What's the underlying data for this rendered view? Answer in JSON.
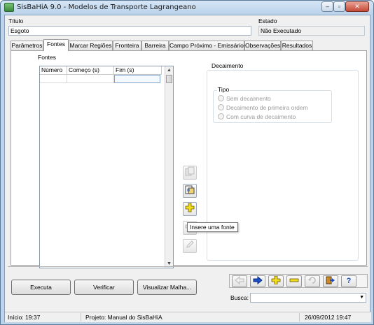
{
  "window": {
    "title": "SisBaHiA 9.0 - Modelos de Transporte Lagrangeano",
    "minimize": "–",
    "maximize": "▫",
    "close": "✕"
  },
  "form": {
    "titulo_label": "Título",
    "titulo_value": "Esgoto",
    "estado_label": "Estado",
    "estado_value": "Não Executado"
  },
  "tabs": [
    {
      "label": "Parâmetros"
    },
    {
      "label": "Fontes"
    },
    {
      "label": "Marcar Regiões"
    },
    {
      "label": "Fronteira"
    },
    {
      "label": "Barreira"
    },
    {
      "label": "Campo Próximo - Emissários"
    },
    {
      "label": "Observações"
    },
    {
      "label": "Resultados"
    }
  ],
  "fontes": {
    "group_label": "Fontes",
    "columns": [
      "Número",
      "Começo (s)",
      "Fim (s)"
    ],
    "scroll_up": "▲",
    "scroll_down": "▼",
    "tooltip": "Insere uma fonte"
  },
  "decaimento": {
    "group_label": "Decaimento",
    "tipo_label": "Tipo",
    "options": [
      "Sem decaimento",
      "Decaimento de primeira ordem",
      "Com curva de decaimento"
    ]
  },
  "buttons": {
    "executa": "Executa",
    "verificar": "Verificar",
    "visualizar": "Visualizar Malha..."
  },
  "busca": {
    "label": "Busca:",
    "value": "",
    "dropdown_arrow": "▼"
  },
  "status": {
    "inicio": "Início: 19:37",
    "projeto": "Projeto: Manual do SisBaHiA",
    "datetime": "26/09/2012 19:47"
  },
  "icon_colors": {
    "arrow": "#1a4fc8",
    "plus": "#e8c800",
    "help": "#1a4fc8"
  }
}
